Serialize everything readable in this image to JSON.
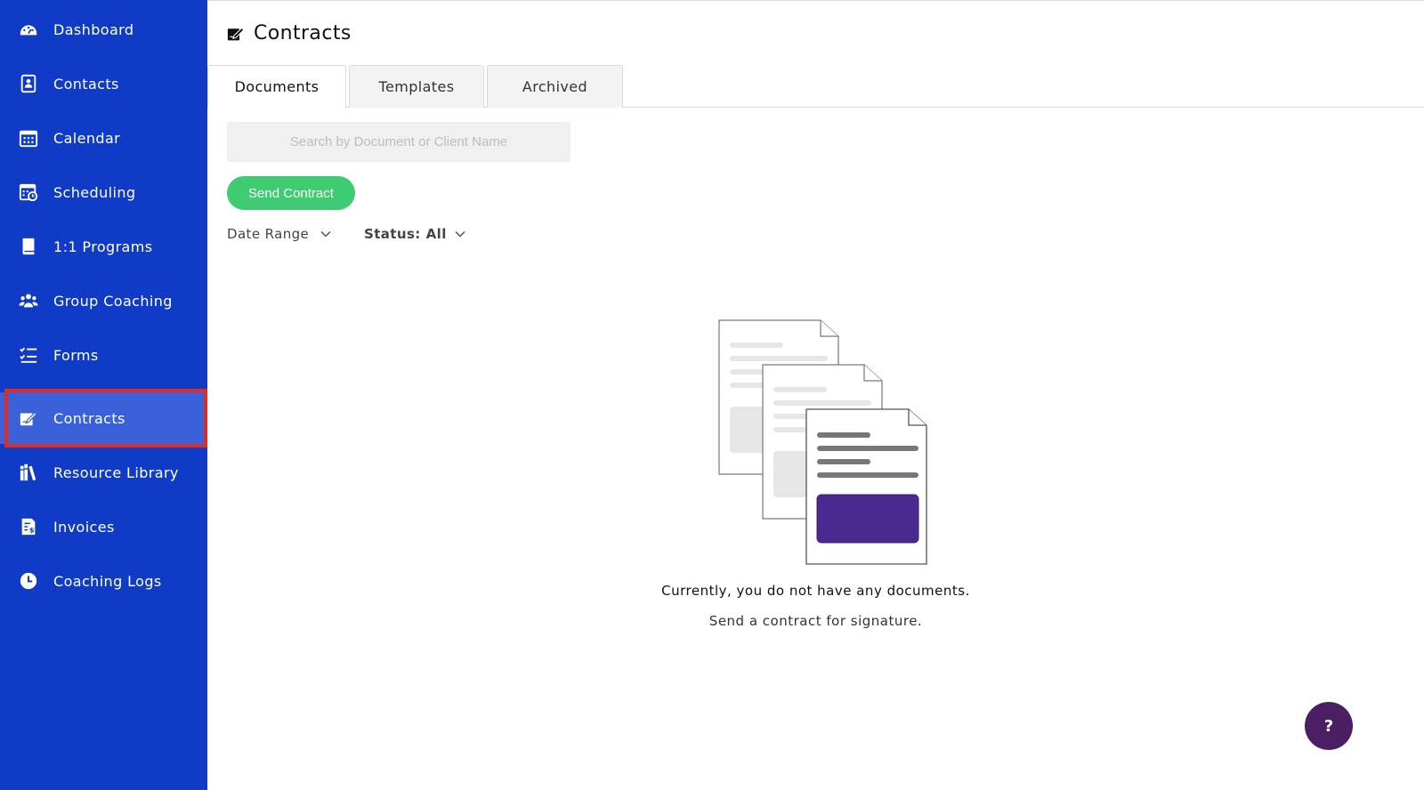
{
  "sidebar": {
    "items": [
      {
        "label": "Dashboard",
        "icon": "dashboard-icon"
      },
      {
        "label": "Contacts",
        "icon": "contacts-icon"
      },
      {
        "label": "Calendar",
        "icon": "calendar-icon"
      },
      {
        "label": "Scheduling",
        "icon": "scheduling-icon"
      },
      {
        "label": "1:1 Programs",
        "icon": "book-icon"
      },
      {
        "label": "Group Coaching",
        "icon": "group-icon"
      },
      {
        "label": "Forms",
        "icon": "checklist-icon"
      },
      {
        "label": "Contracts",
        "icon": "contract-icon",
        "active": true
      },
      {
        "label": "Resource Library",
        "icon": "library-icon"
      },
      {
        "label": "Invoices",
        "icon": "invoice-icon"
      },
      {
        "label": "Coaching Logs",
        "icon": "clock-icon"
      }
    ]
  },
  "header": {
    "title": "Contracts",
    "icon": "contract-icon"
  },
  "tabs": [
    {
      "label": "Documents",
      "active": true
    },
    {
      "label": "Templates"
    },
    {
      "label": "Archived"
    }
  ],
  "search": {
    "placeholder": "Search by Document or Client Name",
    "value": ""
  },
  "actions": {
    "send_contract": "Send Contract"
  },
  "filters": {
    "date_range": "Date Range",
    "status_prefix": "Status:",
    "status_value": "All"
  },
  "empty_state": {
    "title": "Currently, you do not have any documents.",
    "subtitle": "Send a contract for signature."
  },
  "help": {
    "label": "?"
  },
  "colors": {
    "sidebar_bg": "#0f3bc7",
    "sidebar_active": "#3a61d9",
    "active_outline": "#e02b22",
    "send_button": "#3ecb72",
    "help_button": "#4a1f63",
    "doc_highlight": "#4b2a8f"
  }
}
